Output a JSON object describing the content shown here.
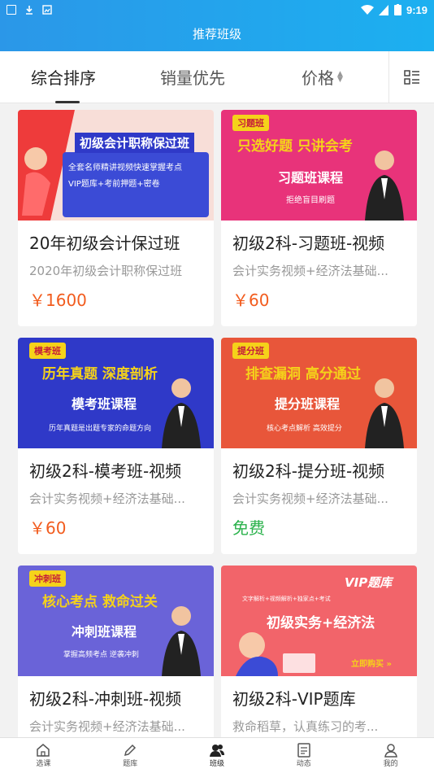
{
  "status_bar": {
    "time": "9:19"
  },
  "header": {
    "title": "推荐班级"
  },
  "sort_tabs": [
    {
      "label": "综合排序",
      "active": true
    },
    {
      "label": "销量优先",
      "active": false
    },
    {
      "label": "价格",
      "active": false
    }
  ],
  "courses": [
    {
      "title": "20年初级会计保过班",
      "subtitle": "2020年初级会计职称保过班",
      "price": "￥1600",
      "price_color": "#f25c1e",
      "banner": {
        "bg": "#f7e4e0",
        "tag": "",
        "line1": "初级会计职称保过班",
        "line2": "全套名师精讲视频快速掌握考点",
        "line3": "VIP题库+考前押题+密卷"
      }
    },
    {
      "title": "初级2科-习题班-视频",
      "subtitle": "会计实务视频+经济法基础...",
      "price": "￥60",
      "price_color": "#f25c1e",
      "banner": {
        "bg": "#e8337a",
        "tag": "习题班",
        "line1": "只选好题 只讲会考",
        "line2": "习题班课程",
        "line3": "拒绝盲目刷题"
      }
    },
    {
      "title": "初级2科-模考班-视频",
      "subtitle": "会计实务视频+经济法基础...",
      "price": "￥60",
      "price_color": "#f25c1e",
      "banner": {
        "bg": "#2f39c8",
        "tag": "模考班",
        "line1": "历年真题 深度剖析",
        "line2": "模考班课程",
        "line3": "历年真题是出题专家的命题方向"
      }
    },
    {
      "title": "初级2科-提分班-视频",
      "subtitle": "会计实务视频+经济法基础...",
      "price": "免费",
      "price_color": "#2bb24c",
      "banner": {
        "bg": "#e8563a",
        "tag": "提分班",
        "line1": "排查漏洞 高分通过",
        "line2": "提分班课程",
        "line3": "核心考点解析  高效提分"
      }
    },
    {
      "title": "初级2科-冲刺班-视频",
      "subtitle": "会计实务视频+经济法基础...",
      "price": "",
      "price_color": "#f25c1e",
      "banner": {
        "bg": "#6a63d8",
        "tag": "冲刺班",
        "line1": "核心考点 救命过关",
        "line2": "冲刺班课程",
        "line3": "掌握高频考点  逆袭冲刺"
      }
    },
    {
      "title": "初级2科-VIP题库",
      "subtitle": "救命稻草，认真练习的考...",
      "price": "",
      "price_color": "#f25c1e",
      "banner": {
        "bg": "#f2646a",
        "tag": "VIP题库",
        "line1": "初级实务+经济法",
        "line2": "文字解析+视频解析+独家点+考试",
        "line3": "立即购买 »"
      }
    }
  ],
  "bottom_nav": [
    {
      "label": "选课",
      "icon": "home-icon",
      "active": false
    },
    {
      "label": "题库",
      "icon": "pencil-icon",
      "active": false
    },
    {
      "label": "班级",
      "icon": "class-icon",
      "active": true
    },
    {
      "label": "动态",
      "icon": "news-icon",
      "active": false
    },
    {
      "label": "我的",
      "icon": "profile-icon",
      "active": false
    }
  ]
}
